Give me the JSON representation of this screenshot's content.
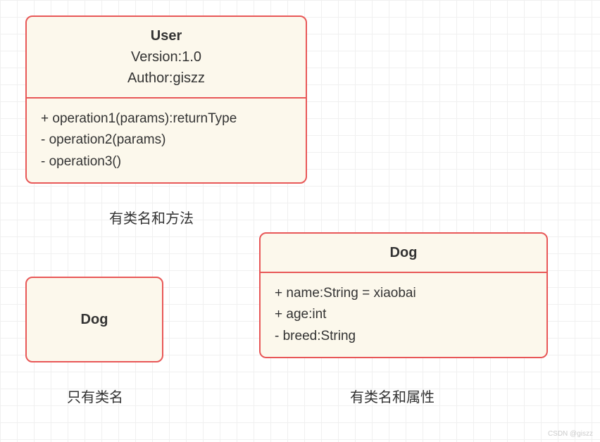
{
  "classes": {
    "user": {
      "name": "User",
      "meta1": "Version:1.0",
      "meta2": "Author:giszz",
      "ops": [
        "+ operation1(params):returnType",
        "- operation2(params)",
        "- operation3()"
      ]
    },
    "dogSimple": {
      "name": "Dog"
    },
    "dogAttrs": {
      "name": "Dog",
      "attrs": [
        "+ name:String = xiaobai",
        "+ age:int",
        "- breed:String"
      ]
    }
  },
  "captions": {
    "userCap": "有类名和方法",
    "dogSimpleCap": "只有类名",
    "dogAttrsCap": "有类名和属性"
  },
  "watermark": "CSDN @giszz"
}
